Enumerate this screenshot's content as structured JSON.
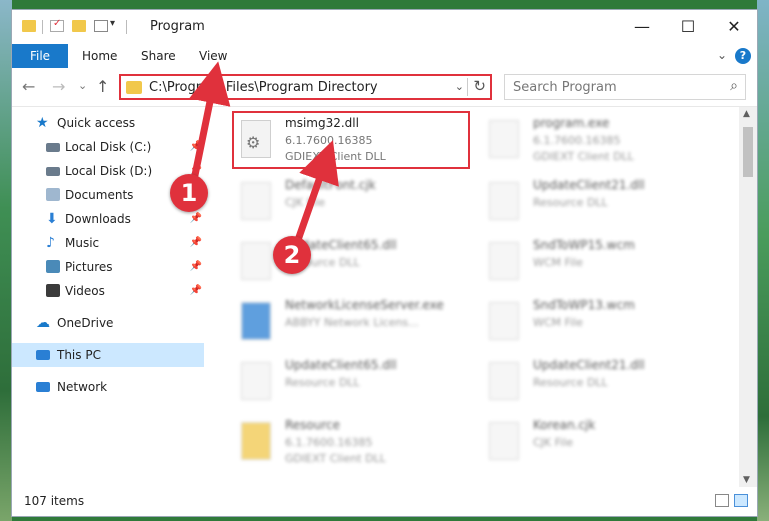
{
  "window": {
    "title": "Program",
    "controls": {
      "minimize": "—",
      "maximize": "☐",
      "close": "✕"
    }
  },
  "ribbon": {
    "tabs": [
      "File",
      "Home",
      "Share",
      "View"
    ],
    "expand": "⌄",
    "help": "?"
  },
  "address": {
    "path": "C:\\Program Files\\Program Directory",
    "dropdown": "⌄",
    "refresh": "↻"
  },
  "search": {
    "placeholder": "Search Program"
  },
  "nav": {
    "back": "←",
    "forward": "→",
    "recent": "⌄",
    "up": "↑"
  },
  "sidebar": {
    "items": [
      {
        "label": "Quick access",
        "icon": "star-icon",
        "color": "#1979ca"
      },
      {
        "label": "Local Disk (C:)",
        "icon": "drive-icon",
        "color": "#6a7b8c"
      },
      {
        "label": "Local Disk (D:)",
        "icon": "drive-icon",
        "color": "#6a7b8c"
      },
      {
        "label": "Documents",
        "icon": "documents-icon",
        "color": "#9fb7cf"
      },
      {
        "label": "Downloads",
        "icon": "download-icon",
        "color": "#2a7fd4"
      },
      {
        "label": "Music",
        "icon": "music-icon",
        "color": "#2a7fd4"
      },
      {
        "label": "Pictures",
        "icon": "pictures-icon",
        "color": "#4a8ab8"
      },
      {
        "label": "Videos",
        "icon": "videos-icon",
        "color": "#3b3b3b"
      },
      {
        "label": "OneDrive",
        "icon": "cloud-icon",
        "color": "#1979ca"
      },
      {
        "label": "This PC",
        "icon": "computer-icon",
        "color": "#2a7fd4"
      },
      {
        "label": "Network",
        "icon": "network-icon",
        "color": "#2a7fd4"
      }
    ],
    "pin": "📌"
  },
  "files": [
    {
      "name": "msimg32.dll",
      "line2": "6.1.7600.16385",
      "line3": "GDIEXT Client DLL",
      "highlight": true
    },
    {
      "name": "program.exe",
      "line2": "6.1.7600.16385",
      "line3": "GDIEXT Client DLL"
    },
    {
      "name": "DefaultFont.cjk",
      "line2": "CJK File",
      "line3": ""
    },
    {
      "name": "UpdateClient21.dll",
      "line2": "Resource DLL",
      "line3": ""
    },
    {
      "name": "UpdateClient65.dll",
      "line2": "Resource DLL",
      "line3": ""
    },
    {
      "name": "SndToWP15.wcm",
      "line2": "WCM File",
      "line3": ""
    },
    {
      "name": "NetworkLicenseServer.exe",
      "line2": "ABBYY Network Licens...",
      "line3": ""
    },
    {
      "name": "SndToWP13.wcm",
      "line2": "WCM File",
      "line3": ""
    },
    {
      "name": "UpdateClient65.dll",
      "line2": "Resource DLL",
      "line3": ""
    },
    {
      "name": "UpdateClient21.dll",
      "line2": "Resource DLL",
      "line3": ""
    },
    {
      "name": "Resource",
      "line2": "6.1.7600.16385",
      "line3": "GDIEXT Client DLL"
    },
    {
      "name": "Korean.cjk",
      "line2": "CJK File",
      "line3": ""
    }
  ],
  "status": {
    "count": "107 items"
  },
  "annotations": [
    {
      "label": "1",
      "color": "#e0313c"
    },
    {
      "label": "2",
      "color": "#e0313c"
    }
  ]
}
